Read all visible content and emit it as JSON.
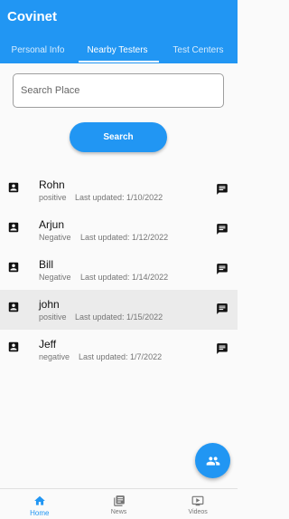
{
  "app": {
    "title": "Covinet"
  },
  "tabs": [
    {
      "label": "Personal Info"
    },
    {
      "label": "Nearby Testers"
    },
    {
      "label": "Test Centers"
    }
  ],
  "search": {
    "placeholder": "Search Place",
    "value": "",
    "button_label": "Search"
  },
  "testers": [
    {
      "name": "Rohn",
      "status": "positive",
      "updated": "Last updated: 1/10/2022"
    },
    {
      "name": "Arjun",
      "status": "Negative",
      "updated": "Last updated: 1/12/2022"
    },
    {
      "name": "Bill",
      "status": "Negative",
      "updated": "Last updated: 1/14/2022"
    },
    {
      "name": "john",
      "status": "positive",
      "updated": "Last updated: 1/15/2022"
    },
    {
      "name": "Jeff",
      "status": "negative",
      "updated": "Last updated: 1/7/2022"
    }
  ],
  "bottom_nav": [
    {
      "label": "Home",
      "icon": "home-icon"
    },
    {
      "label": "News",
      "icon": "news-icon"
    },
    {
      "label": "Videos",
      "icon": "video-icon"
    }
  ],
  "colors": {
    "primary": "#2196f3",
    "selected_row": "#ebebeb"
  }
}
